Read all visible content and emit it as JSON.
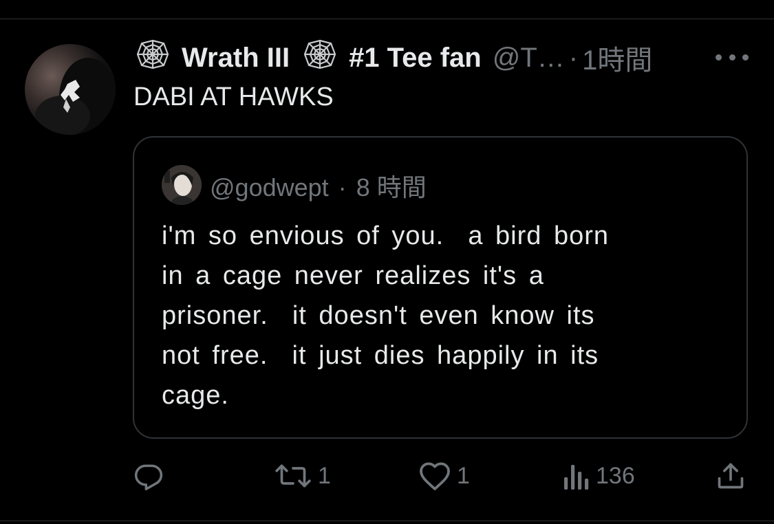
{
  "tweet": {
    "display_name_part1": "Wrath III",
    "display_name_part2": "#1 Tee fan",
    "handle": "@T…",
    "separator": "·",
    "time": "1時間",
    "text": "DABI AT HAWKS"
  },
  "quote": {
    "handle": "@godwept",
    "separator": "·",
    "time": "8 時間",
    "text": "i'm so envious of you.  a bird born\nin a cage never realizes it's a\nprisoner.  it doesn't even know its\nnot free.  it just dies happily in its\ncage."
  },
  "actions": {
    "reply_count": "",
    "retweet_count": "1",
    "like_count": "1",
    "views_count": "136"
  },
  "colors": {
    "background": "#000000",
    "text_primary": "#e7e9ea",
    "text_secondary": "#71767b",
    "border": "#2f3336"
  },
  "icons": {
    "name_emoji": "spider-web-icon",
    "more": "more-dots-icon",
    "reply": "reply-icon",
    "retweet": "retweet-icon",
    "like": "heart-icon",
    "views": "views-icon",
    "share": "share-icon"
  }
}
